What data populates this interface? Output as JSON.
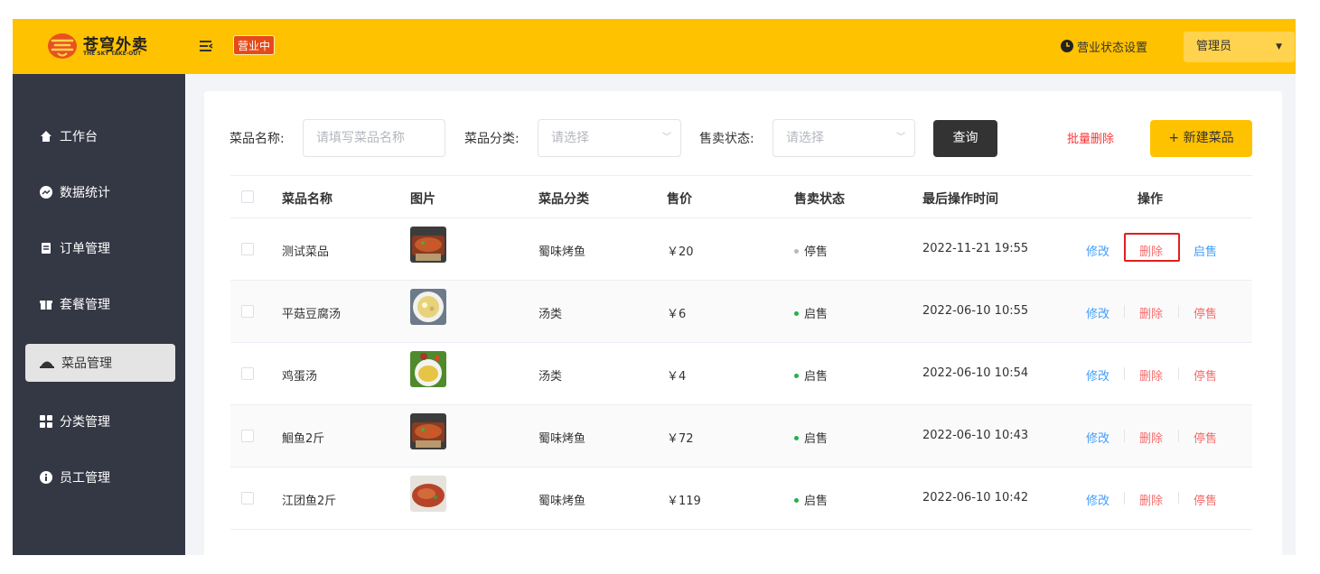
{
  "header": {
    "logo_title": "苍穹外卖",
    "logo_subtitle": "THE SKY TAKE-OUT",
    "status_tag": "营业中",
    "biz_status_setting": "营业状态设置",
    "admin_label": "管理员",
    "brand_color": "#ffc200"
  },
  "sidebar": {
    "items": [
      {
        "label": "工作台",
        "icon": "home-icon"
      },
      {
        "label": "数据统计",
        "icon": "chart-icon"
      },
      {
        "label": "订单管理",
        "icon": "clipboard-icon"
      },
      {
        "label": "套餐管理",
        "icon": "gift-icon"
      },
      {
        "label": "菜品管理",
        "icon": "dish-cover-icon",
        "active": true
      },
      {
        "label": "分类管理",
        "icon": "grid-icon"
      },
      {
        "label": "员工管理",
        "icon": "info-icon"
      }
    ]
  },
  "filters": {
    "name_label": "菜品名称:",
    "name_placeholder": "请填写菜品名称",
    "category_label": "菜品分类:",
    "category_placeholder": "请选择",
    "status_label": "售卖状态:",
    "status_placeholder": "请选择",
    "query_button": "查询",
    "batch_delete": "批量删除",
    "new_dish_button": "+ 新建菜品"
  },
  "table": {
    "columns": [
      "菜品名称",
      "图片",
      "菜品分类",
      "售价",
      "售卖状态",
      "最后操作时间",
      "操作"
    ],
    "rows": [
      {
        "name": "测试菜品",
        "category": "蜀味烤鱼",
        "price": "￥20",
        "status": "停售",
        "time": "2022-11-21 19:55",
        "edit": "修改",
        "delete": "删除",
        "toggle": "启售",
        "image": "grilled-fish"
      },
      {
        "name": "平菇豆腐汤",
        "category": "汤类",
        "price": "￥6",
        "status": "启售",
        "time": "2022-06-10 10:55",
        "edit": "修改",
        "delete": "删除",
        "toggle": "停售",
        "image": "tofu-soup"
      },
      {
        "name": "鸡蛋汤",
        "category": "汤类",
        "price": "￥4",
        "status": "启售",
        "time": "2022-06-10 10:54",
        "edit": "修改",
        "delete": "删除",
        "toggle": "停售",
        "image": "egg-soup"
      },
      {
        "name": "鮰鱼2斤",
        "category": "蜀味烤鱼",
        "price": "￥72",
        "status": "启售",
        "time": "2022-06-10 10:43",
        "edit": "修改",
        "delete": "删除",
        "toggle": "停售",
        "image": "grilled-fish"
      },
      {
        "name": "江团鱼2斤",
        "category": "蜀味烤鱼",
        "price": "￥119",
        "status": "启售",
        "time": "2022-06-10 10:42",
        "edit": "修改",
        "delete": "删除",
        "toggle": "停售",
        "image": "spicy-fish"
      }
    ]
  },
  "colors": {
    "status_on": "#22b24c",
    "status_off": "#b9b9b9",
    "link_blue": "#419eff",
    "link_red": "#f56c6c",
    "highlight_box": "#e02020"
  }
}
